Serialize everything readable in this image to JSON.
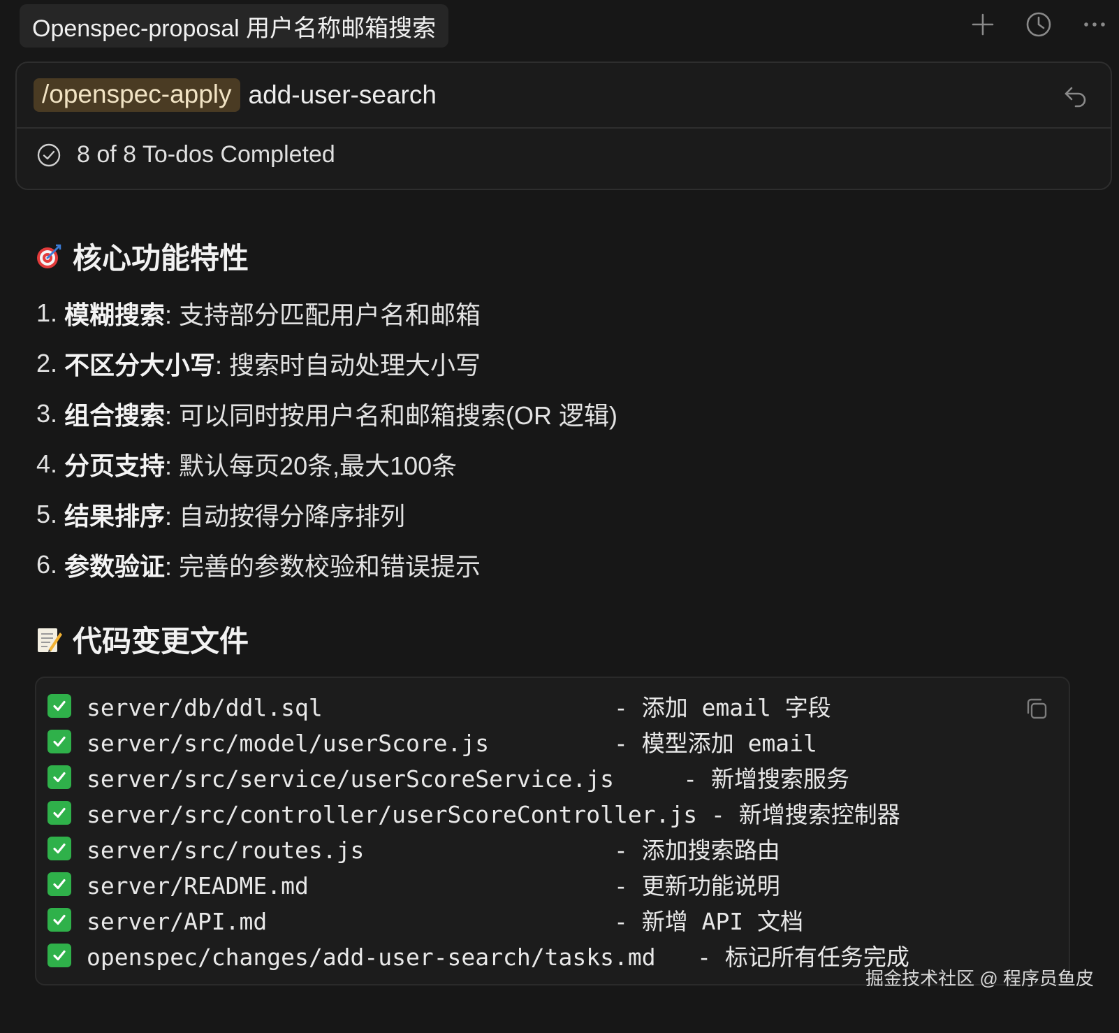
{
  "tab": {
    "title": "Openspec-proposal 用户名称邮箱搜索"
  },
  "toolbar": {
    "icons": [
      "plus-icon",
      "clock-icon",
      "more-icon"
    ]
  },
  "composer": {
    "command": "/openspec-apply",
    "argument": "add-user-search"
  },
  "todos": {
    "status": "8 of 8 To-dos Completed"
  },
  "section1": {
    "emoji": "target-emoji",
    "title": "核心功能特性",
    "items": [
      {
        "num": "1.",
        "label": "模糊搜索",
        "desc": ": 支持部分匹配用户名和邮箱"
      },
      {
        "num": "2.",
        "label": "不区分大小写",
        "desc": ": 搜索时自动处理大小写"
      },
      {
        "num": "3.",
        "label": "组合搜索",
        "desc": ": 可以同时按用户名和邮箱搜索(OR 逻辑)"
      },
      {
        "num": "4.",
        "label": "分页支持",
        "desc": ": 默认每页20条,最大100条"
      },
      {
        "num": "5.",
        "label": "结果排序",
        "desc": ": 自动按得分降序排列"
      },
      {
        "num": "6.",
        "label": "参数验证",
        "desc": ": 完善的参数校验和错误提示"
      }
    ]
  },
  "section2": {
    "emoji": "memo-emoji",
    "title": "代码变更文件",
    "lines": [
      "server/db/ddl.sql                     - 添加 email 字段",
      "server/src/model/userScore.js         - 模型添加 email",
      "server/src/service/userScoreService.js     - 新增搜索服务",
      "server/src/controller/userScoreController.js - 新增搜索控制器",
      "server/src/routes.js                  - 添加搜索路由",
      "server/README.md                      - 更新功能说明",
      "server/API.md                         - 新增 API 文档",
      "openspec/changes/add-user-search/tasks.md   - 标记所有任务完成"
    ]
  },
  "watermark": "掘金技术社区 @ 程序员鱼皮",
  "colors": {
    "background": "#171717",
    "chip": "#4a3b23",
    "check": "#2fb14a"
  }
}
